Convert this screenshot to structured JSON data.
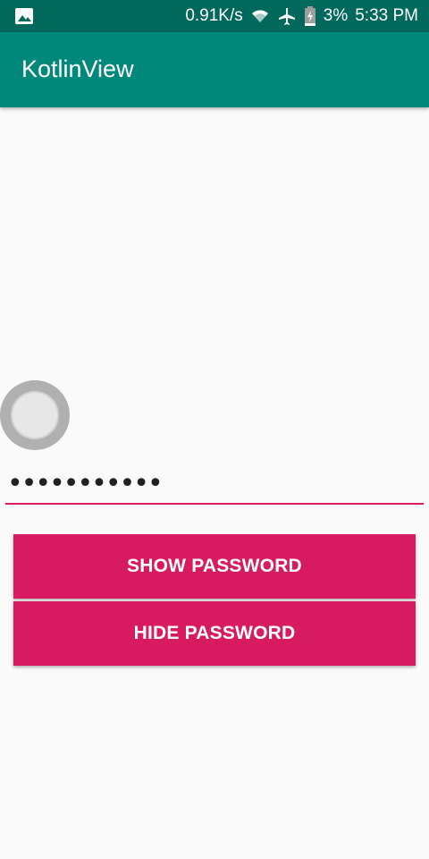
{
  "status_bar": {
    "net_speed": "0.91K/s",
    "battery_percent": "3%",
    "time": "5:33 PM",
    "icons": [
      "image-icon",
      "wifi-icon",
      "airplane-icon",
      "battery-charging-icon"
    ]
  },
  "app_bar": {
    "title": "KotlinView"
  },
  "password_field": {
    "value": "•••••••••••"
  },
  "buttons": {
    "show_label": "SHOW PASSWORD",
    "hide_label": "HIDE PASSWORD"
  },
  "colors": {
    "status_bar": "#00695c",
    "app_bar": "#00897b",
    "accent": "#d81b60",
    "background": "#fafafa"
  }
}
